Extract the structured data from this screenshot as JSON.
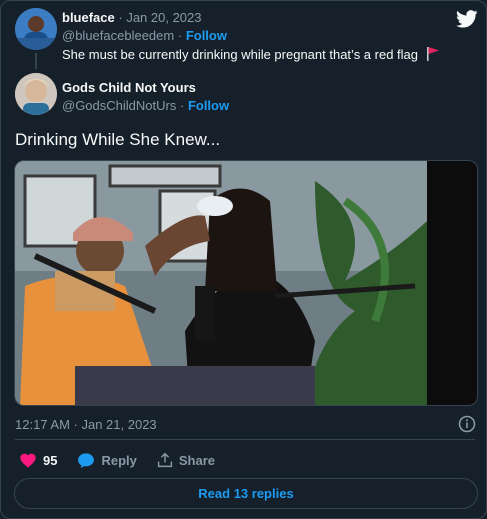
{
  "parent_tweet": {
    "name": "blueface",
    "date": "· Jan 20, 2023",
    "handle": "@bluefacebleedem",
    "sep": "·",
    "follow": "Follow",
    "text": "She must be currently drinking while pregnant that’s a red flag"
  },
  "tweet": {
    "name": "Gods Child Not Yours",
    "handle": "@GodsChildNotUrs",
    "sep": "·",
    "follow": "Follow",
    "text": "Drinking While She Knew...",
    "timestamp": "12:17 AM · Jan 21, 2023"
  },
  "actions": {
    "likes": "95",
    "reply": "Reply",
    "share": "Share"
  },
  "read_replies": "Read 13 replies",
  "colors": {
    "background": "#15202b",
    "accent": "#1d9bf0",
    "heart": "#f91880",
    "muted": "#8b98a5"
  }
}
